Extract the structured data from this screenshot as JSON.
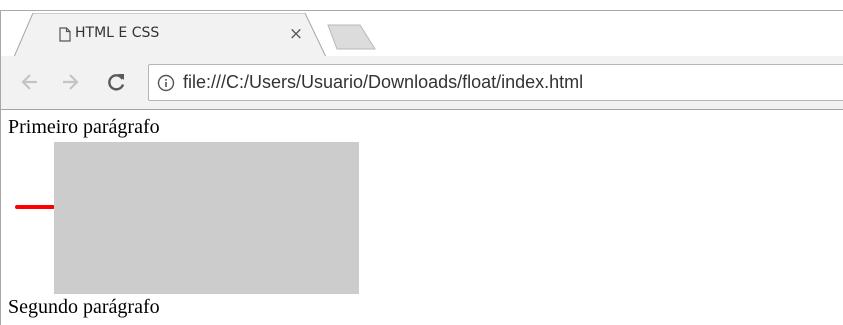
{
  "tab": {
    "title": "HTML E CSS",
    "page_icon": "page-icon",
    "close_icon": "close-icon",
    "close_glyph": "×"
  },
  "new_tab_icon": "new-tab-button",
  "toolbar": {
    "back_icon": "back-arrow-icon",
    "forward_icon": "forward-arrow-icon",
    "reload_icon": "reload-icon",
    "info_icon": "info-icon",
    "url": "file:///C:/Users/Usuario/Downloads/float/index.html"
  },
  "content": {
    "paragraph_1": "Primeiro parágrafo",
    "paragraph_2": "Segundo parágrafo",
    "marker_color": "#ff0000",
    "box_color": "#cccccc"
  }
}
